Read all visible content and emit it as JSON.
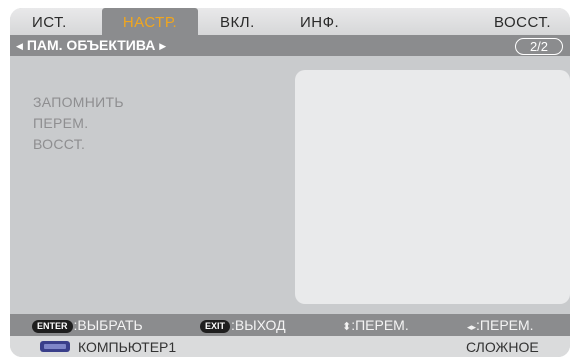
{
  "tabs": [
    {
      "label": "ИСТ."
    },
    {
      "label": "НАСТР."
    },
    {
      "label": "ВКЛ."
    },
    {
      "label": "ИНФ."
    },
    {
      "label": "ВОССТ."
    }
  ],
  "active_tab": "НАСТР.",
  "submenu": {
    "title": "ПАМ. ОБЪЕКТИВА",
    "page": "2/2"
  },
  "menu_items": [
    {
      "label": "ЗАПОМНИТЬ"
    },
    {
      "label": "ПЕРЕМ."
    },
    {
      "label": "ВОССТ."
    }
  ],
  "help": {
    "enter_key": "ENTER",
    "enter_label": ":ВЫБРАТЬ",
    "exit_key": "EXIT",
    "exit_label": ":ВЫХОД",
    "updown_label": ":ПЕРЕМ.",
    "leftright_label": ":ПЕРЕМ."
  },
  "status": {
    "source": "КОМПЬЮТЕР1",
    "mode": "СЛОЖНОЕ"
  },
  "colors": {
    "active_tab_text": "#f0a61e",
    "bar_gray": "#8b8c8e",
    "source_icon": "#3a3f8a"
  }
}
